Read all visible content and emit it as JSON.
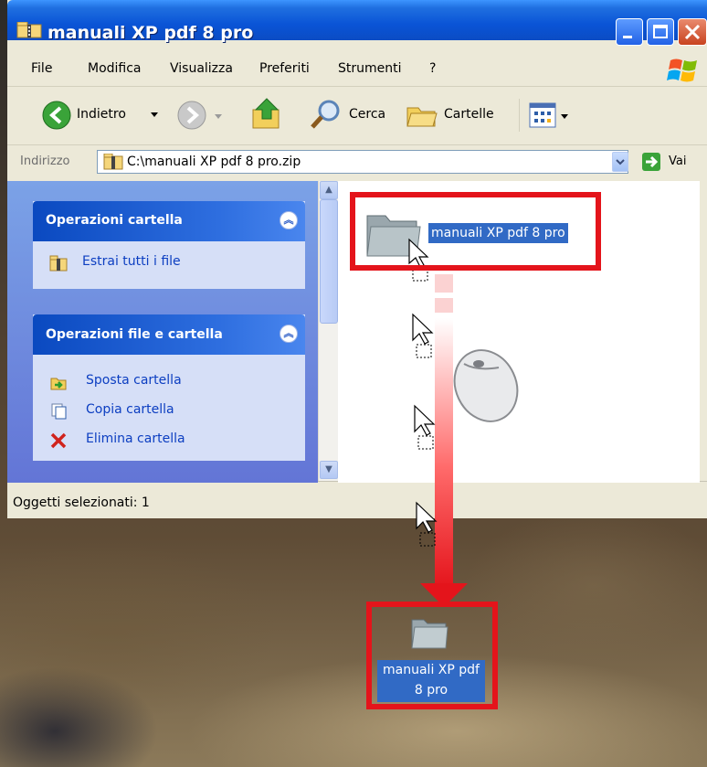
{
  "window": {
    "title": "manuali XP pdf 8 pro"
  },
  "menu": {
    "items": [
      "File",
      "Modifica",
      "Visualizza",
      "Preferiti",
      "Strumenti",
      "?"
    ]
  },
  "toolbar": {
    "back_label": "Indietro",
    "search_label": "Cerca",
    "folders_label": "Cartelle"
  },
  "address": {
    "label": "Indirizzo",
    "value": "C:\\manuali XP pdf 8 pro.zip",
    "go_label": "Vai"
  },
  "left_pane": {
    "folder_tasks": {
      "title": "Operazioni cartella",
      "items": [
        {
          "label": "Estrai tutti i file",
          "icon": "zip-folder-icon"
        }
      ]
    },
    "file_tasks": {
      "title": "Operazioni file e cartella",
      "items": [
        {
          "label": "Sposta cartella",
          "icon": "move-icon"
        },
        {
          "label": "Copia cartella",
          "icon": "copy-icon"
        },
        {
          "label": "Elimina cartella",
          "icon": "delete-icon"
        }
      ]
    }
  },
  "right_pane": {
    "folder_name": "manuali XP pdf 8 pro"
  },
  "status_bar": {
    "text": "Oggetti selezionati: 1"
  },
  "desktop": {
    "icon_label_line1": "manuali XP pdf",
    "icon_label_line2": "8 pro"
  },
  "colors": {
    "highlight": "#e4141b",
    "selection": "#316ac5",
    "titlebar": "#0a54d6"
  }
}
